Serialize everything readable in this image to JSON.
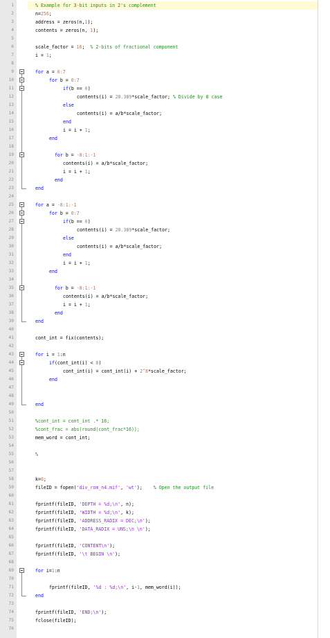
{
  "lines": [
    {
      "n": "1",
      "ind": 0,
      "parts": [
        {
          "t": "% Example for 3-bit inputs in 2's complement",
          "c": "cm"
        }
      ]
    },
    {
      "n": "2",
      "ind": 0,
      "parts": [
        {
          "t": "n=",
          "c": ""
        },
        {
          "t": "256",
          "c": "num"
        },
        {
          "t": ";",
          "c": ""
        }
      ]
    },
    {
      "n": "3",
      "ind": 0,
      "parts": [
        {
          "t": "address = zeros(n,",
          "c": ""
        },
        {
          "t": "1",
          "c": "num"
        },
        {
          "t": ");",
          "c": ""
        }
      ]
    },
    {
      "n": "4",
      "ind": 0,
      "parts": [
        {
          "t": "contents = zeros(n, ",
          "c": ""
        },
        {
          "t": "1",
          "c": "num"
        },
        {
          "t": ");",
          "c": ""
        }
      ]
    },
    {
      "n": "5",
      "ind": 0,
      "parts": []
    },
    {
      "n": "6",
      "ind": 0,
      "parts": [
        {
          "t": "scale_factor = ",
          "c": ""
        },
        {
          "t": "16",
          "c": "num"
        },
        {
          "t": ";  ",
          "c": ""
        },
        {
          "t": "% 2-bits of fractional component",
          "c": "cm"
        }
      ]
    },
    {
      "n": "7",
      "ind": 0,
      "parts": [
        {
          "t": "i = ",
          "c": ""
        },
        {
          "t": "1",
          "c": "num"
        },
        {
          "t": ";",
          "c": ""
        }
      ]
    },
    {
      "n": "8",
      "ind": 0,
      "parts": []
    },
    {
      "n": "9",
      "ind": 0,
      "fold": "open",
      "parts": [
        {
          "t": "for",
          "c": "kw"
        },
        {
          "t": " a = ",
          "c": ""
        },
        {
          "t": "0:7",
          "c": "num"
        }
      ]
    },
    {
      "n": "10",
      "ind": 1,
      "fold": "open",
      "parts": [
        {
          "t": "for",
          "c": "kw"
        },
        {
          "t": " b = ",
          "c": ""
        },
        {
          "t": "0:7",
          "c": "num"
        }
      ]
    },
    {
      "n": "11",
      "ind": 2,
      "fold": "open",
      "parts": [
        {
          "t": "if",
          "c": "kw"
        },
        {
          "t": "(b == ",
          "c": ""
        },
        {
          "t": "0",
          "c": "num"
        },
        {
          "t": ")",
          "c": ""
        }
      ]
    },
    {
      "n": "12",
      "ind": 3,
      "parts": [
        {
          "t": "contents(i) = ",
          "c": ""
        },
        {
          "t": "28.389",
          "c": "num"
        },
        {
          "t": "*scale_factor; ",
          "c": ""
        },
        {
          "t": "% Divide by 0 case",
          "c": "cm"
        }
      ]
    },
    {
      "n": "13",
      "ind": 2,
      "parts": [
        {
          "t": "else",
          "c": "kw"
        }
      ]
    },
    {
      "n": "14",
      "ind": 3,
      "parts": [
        {
          "t": "contents(i) = a/b*scale_factor;",
          "c": ""
        }
      ]
    },
    {
      "n": "15",
      "ind": 2,
      "parts": [
        {
          "t": "end",
          "c": "kw"
        }
      ]
    },
    {
      "n": "16",
      "ind": 2,
      "parts": [
        {
          "t": "i = i + ",
          "c": ""
        },
        {
          "t": "1",
          "c": "num"
        },
        {
          "t": ";",
          "c": ""
        }
      ]
    },
    {
      "n": "17",
      "ind": 1,
      "parts": [
        {
          "t": "end",
          "c": "kw"
        }
      ]
    },
    {
      "n": "18",
      "ind": 0,
      "parts": []
    },
    {
      "n": "19",
      "ind": 1,
      "fold": "open",
      "parts": [
        {
          "t": "  for",
          "c": "kw"
        },
        {
          "t": " b = ",
          "c": ""
        },
        {
          "t": "-8:1:-1",
          "c": "num"
        }
      ]
    },
    {
      "n": "20",
      "ind": 2,
      "parts": [
        {
          "t": "contents(i) = a/b*scale_factor;",
          "c": ""
        }
      ]
    },
    {
      "n": "21",
      "ind": 2,
      "parts": [
        {
          "t": "i = i + ",
          "c": ""
        },
        {
          "t": "1",
          "c": "num"
        },
        {
          "t": ";",
          "c": ""
        }
      ]
    },
    {
      "n": "22",
      "ind": 1,
      "parts": [
        {
          "t": "  end",
          "c": "kw"
        }
      ]
    },
    {
      "n": "23",
      "ind": 0,
      "end": true,
      "parts": [
        {
          "t": "end",
          "c": "kw"
        }
      ]
    },
    {
      "n": "24",
      "ind": 0,
      "parts": []
    },
    {
      "n": "25",
      "ind": 0,
      "fold": "open",
      "parts": [
        {
          "t": "for",
          "c": "kw"
        },
        {
          "t": " a = ",
          "c": ""
        },
        {
          "t": "-8:1:-1",
          "c": "num"
        }
      ]
    },
    {
      "n": "26",
      "ind": 1,
      "fold": "open",
      "parts": [
        {
          "t": "for",
          "c": "kw"
        },
        {
          "t": " b = ",
          "c": ""
        },
        {
          "t": "0:7",
          "c": "num"
        }
      ]
    },
    {
      "n": "27",
      "ind": 2,
      "fold": "open",
      "parts": [
        {
          "t": "if",
          "c": "kw"
        },
        {
          "t": "(b == ",
          "c": ""
        },
        {
          "t": "0",
          "c": "num"
        },
        {
          "t": ")",
          "c": ""
        }
      ]
    },
    {
      "n": "28",
      "ind": 3,
      "parts": [
        {
          "t": "contents(i) = ",
          "c": ""
        },
        {
          "t": "28.389",
          "c": "num"
        },
        {
          "t": "*scale_factor;",
          "c": ""
        }
      ]
    },
    {
      "n": "29",
      "ind": 2,
      "parts": [
        {
          "t": "else",
          "c": "kw"
        }
      ]
    },
    {
      "n": "30",
      "ind": 3,
      "parts": [
        {
          "t": "contents(i) = a/b*scale_factor;",
          "c": ""
        }
      ]
    },
    {
      "n": "31",
      "ind": 2,
      "parts": [
        {
          "t": "end",
          "c": "kw"
        }
      ]
    },
    {
      "n": "32",
      "ind": 2,
      "parts": [
        {
          "t": "i = i + ",
          "c": ""
        },
        {
          "t": "1",
          "c": "num"
        },
        {
          "t": ";",
          "c": ""
        }
      ]
    },
    {
      "n": "33",
      "ind": 1,
      "parts": [
        {
          "t": "end",
          "c": "kw"
        }
      ]
    },
    {
      "n": "34",
      "ind": 0,
      "parts": []
    },
    {
      "n": "35",
      "ind": 1,
      "fold": "open",
      "parts": [
        {
          "t": "  for",
          "c": "kw"
        },
        {
          "t": " b = ",
          "c": ""
        },
        {
          "t": "-8:1:-1",
          "c": "num"
        }
      ]
    },
    {
      "n": "36",
      "ind": 2,
      "parts": [
        {
          "t": "contents(i) = a/b*scale_factor;",
          "c": ""
        }
      ]
    },
    {
      "n": "37",
      "ind": 2,
      "parts": [
        {
          "t": "i = i + ",
          "c": ""
        },
        {
          "t": "1",
          "c": "num"
        },
        {
          "t": ";",
          "c": ""
        }
      ]
    },
    {
      "n": "38",
      "ind": 1,
      "parts": [
        {
          "t": "  end",
          "c": "kw"
        }
      ]
    },
    {
      "n": "39",
      "ind": 0,
      "end": true,
      "parts": [
        {
          "t": "end",
          "c": "kw"
        }
      ]
    },
    {
      "n": "40",
      "ind": 0,
      "parts": []
    },
    {
      "n": "41",
      "ind": 0,
      "parts": [
        {
          "t": "cont_int = fix(contents);",
          "c": ""
        }
      ]
    },
    {
      "n": "42",
      "ind": 0,
      "parts": []
    },
    {
      "n": "43",
      "ind": 0,
      "fold": "open",
      "parts": [
        {
          "t": "for",
          "c": "kw"
        },
        {
          "t": " i = ",
          "c": ""
        },
        {
          "t": "1",
          "c": "num"
        },
        {
          "t": ":n",
          "c": ""
        }
      ]
    },
    {
      "n": "44",
      "ind": 1,
      "fold": "open",
      "parts": [
        {
          "t": "if",
          "c": "kw"
        },
        {
          "t": "(cont_int(i) < ",
          "c": ""
        },
        {
          "t": "0",
          "c": "num"
        },
        {
          "t": ")",
          "c": ""
        }
      ]
    },
    {
      "n": "45",
      "ind": 2,
      "parts": [
        {
          "t": "cont_int(i) = cont_int(i) + ",
          "c": ""
        },
        {
          "t": "2^8",
          "c": "num"
        },
        {
          "t": "*scale_factor;",
          "c": ""
        }
      ]
    },
    {
      "n": "46",
      "ind": 1,
      "parts": [
        {
          "t": "end",
          "c": "kw"
        }
      ]
    },
    {
      "n": "47",
      "ind": 0,
      "parts": []
    },
    {
      "n": "48",
      "ind": 0,
      "parts": []
    },
    {
      "n": "49",
      "ind": 0,
      "end": true,
      "parts": [
        {
          "t": "end",
          "c": "kw"
        }
      ]
    },
    {
      "n": "50",
      "ind": 0,
      "parts": []
    },
    {
      "n": "51",
      "ind": 0,
      "parts": [
        {
          "t": "%cont_int = cont_int .* 16;",
          "c": "cm"
        }
      ]
    },
    {
      "n": "52",
      "ind": 0,
      "parts": [
        {
          "t": "%cont_frac = abs(round(cont_frac*16));",
          "c": "cm"
        }
      ]
    },
    {
      "n": "53",
      "ind": 0,
      "parts": [
        {
          "t": "mem_word = cont_int;",
          "c": ""
        }
      ]
    },
    {
      "n": "54",
      "ind": 0,
      "parts": []
    },
    {
      "n": "55",
      "ind": 0,
      "parts": [
        {
          "t": "%",
          "c": "cm"
        }
      ]
    },
    {
      "n": "56",
      "ind": 0,
      "parts": []
    },
    {
      "n": "57",
      "ind": 0,
      "parts": []
    },
    {
      "n": "58",
      "ind": 0,
      "parts": [
        {
          "t": "k=",
          "c": ""
        },
        {
          "t": "0",
          "c": "num"
        },
        {
          "t": ";",
          "c": ""
        }
      ]
    },
    {
      "n": "59",
      "ind": 0,
      "parts": [
        {
          "t": "fileID = fopen(",
          "c": ""
        },
        {
          "t": "'div_rom_n4.mif'",
          "c": "str"
        },
        {
          "t": ", ",
          "c": ""
        },
        {
          "t": "'wt'",
          "c": "str"
        },
        {
          "t": ");    ",
          "c": ""
        },
        {
          "t": "% Open the output file",
          "c": "cm"
        }
      ]
    },
    {
      "n": "60",
      "ind": 0,
      "parts": []
    },
    {
      "n": "61",
      "ind": 0,
      "parts": [
        {
          "t": "fprintf(fileID, ",
          "c": ""
        },
        {
          "t": "'DEPTH = %d;\\n'",
          "c": "str"
        },
        {
          "t": ", n);",
          "c": ""
        }
      ]
    },
    {
      "n": "62",
      "ind": 0,
      "parts": [
        {
          "t": "fprintf(fileID, ",
          "c": ""
        },
        {
          "t": "'WIDTH = %d;\\n'",
          "c": "str"
        },
        {
          "t": ", k);",
          "c": ""
        }
      ]
    },
    {
      "n": "63",
      "ind": 0,
      "parts": [
        {
          "t": "fprintf(fileID, ",
          "c": ""
        },
        {
          "t": "'ADDRESS_RADIX = DEC;\\n'",
          "c": "str"
        },
        {
          "t": ");",
          "c": ""
        }
      ]
    },
    {
      "n": "64",
      "ind": 0,
      "parts": [
        {
          "t": "fprintf(fileID, ",
          "c": ""
        },
        {
          "t": "'DATA_RADIX = UNS;\\n \\n'",
          "c": "str"
        },
        {
          "t": ");",
          "c": ""
        }
      ]
    },
    {
      "n": "65",
      "ind": 0,
      "parts": []
    },
    {
      "n": "66",
      "ind": 0,
      "parts": [
        {
          "t": "fprintf(fileID, ",
          "c": ""
        },
        {
          "t": "'CONTENT\\n'",
          "c": "str"
        },
        {
          "t": ");",
          "c": ""
        }
      ]
    },
    {
      "n": "67",
      "ind": 0,
      "parts": [
        {
          "t": "fprintf(fileID, ",
          "c": ""
        },
        {
          "t": "'\\t BEGIN \\n'",
          "c": "str"
        },
        {
          "t": ");",
          "c": ""
        }
      ]
    },
    {
      "n": "68",
      "ind": 0,
      "parts": []
    },
    {
      "n": "69",
      "ind": 0,
      "fold": "open",
      "parts": [
        {
          "t": "for",
          "c": "kw"
        },
        {
          "t": " i=",
          "c": ""
        },
        {
          "t": "1",
          "c": "num"
        },
        {
          "t": ":n",
          "c": ""
        }
      ]
    },
    {
      "n": "70",
      "ind": 0,
      "parts": []
    },
    {
      "n": "71",
      "ind": 1,
      "parts": [
        {
          "t": "fprintf(fileID, ",
          "c": ""
        },
        {
          "t": "'%d : %d;\\n'",
          "c": "str"
        },
        {
          "t": ", i-",
          "c": ""
        },
        {
          "t": "1",
          "c": "num"
        },
        {
          "t": ", mem_word(i));",
          "c": ""
        }
      ]
    },
    {
      "n": "72",
      "ind": 0,
      "end": true,
      "parts": [
        {
          "t": "end",
          "c": "kw"
        }
      ]
    },
    {
      "n": "73",
      "ind": 0,
      "parts": []
    },
    {
      "n": "74",
      "ind": 0,
      "parts": [
        {
          "t": "fprintf(fileID, ",
          "c": ""
        },
        {
          "t": "'END;\\n'",
          "c": "str"
        },
        {
          "t": ");",
          "c": ""
        }
      ]
    },
    {
      "n": "75",
      "ind": 0,
      "parts": [
        {
          "t": "fclose(fileID);",
          "c": ""
        }
      ]
    },
    {
      "n": "76",
      "ind": 0,
      "parts": []
    }
  ]
}
